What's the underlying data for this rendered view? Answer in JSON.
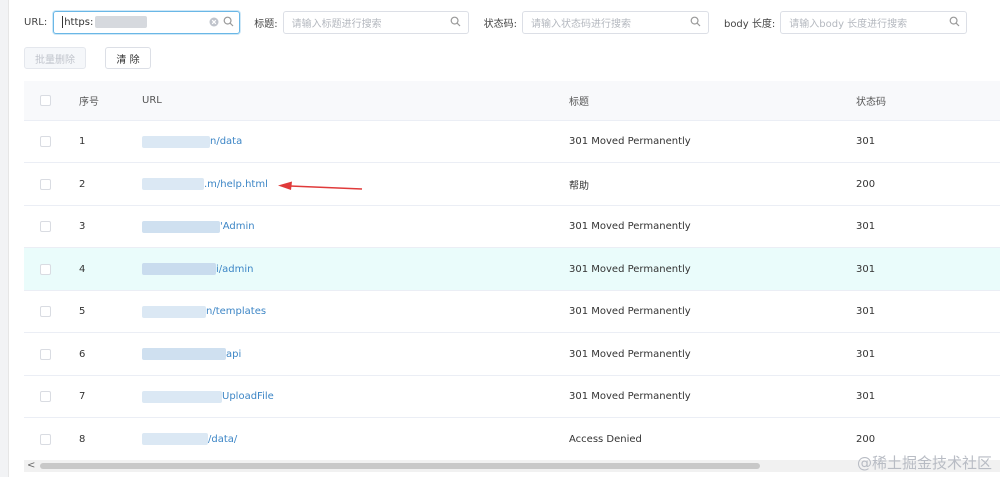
{
  "filters": {
    "url": {
      "label": "URL:",
      "value": "https:"
    },
    "title": {
      "label": "标题:",
      "placeholder": "请输入标题进行搜索"
    },
    "status": {
      "label": "状态码:",
      "placeholder": "请输入状态码进行搜索"
    },
    "body_length": {
      "label": "body 长度:",
      "placeholder": "请输入body 长度进行搜索"
    }
  },
  "actions": {
    "batch_delete": "批量删除",
    "clear": "清 除"
  },
  "table": {
    "headers": {
      "index": "序号",
      "url": "URL",
      "title": "标题",
      "status": "状态码"
    },
    "rows": [
      {
        "index": "1",
        "url": "n/data",
        "title": "301 Moved Permanently",
        "status": "301"
      },
      {
        "index": "2",
        "url": ".m/help.html",
        "title": "帮助",
        "status": "200"
      },
      {
        "index": "3",
        "url": "'Admin",
        "title": "301 Moved Permanently",
        "status": "301"
      },
      {
        "index": "4",
        "url": "i/admin",
        "title": "301 Moved Permanently",
        "status": "301"
      },
      {
        "index": "5",
        "url": "n/templates",
        "title": "301 Moved Permanently",
        "status": "301"
      },
      {
        "index": "6",
        "url": "api",
        "title": "301 Moved Permanently",
        "status": "301"
      },
      {
        "index": "7",
        "url": "UploadFile",
        "title": "301 Moved Permanently",
        "status": "301"
      },
      {
        "index": "8",
        "url": "/data/",
        "title": "Access Denied",
        "status": "200"
      }
    ]
  },
  "scrollbar": {
    "left_arrow": "<"
  },
  "watermark": "@稀土掘金技术社区",
  "colors": {
    "accent": "#3d86c6",
    "highlight_row": "#eafcfb",
    "arrow": "#e03a3a"
  }
}
